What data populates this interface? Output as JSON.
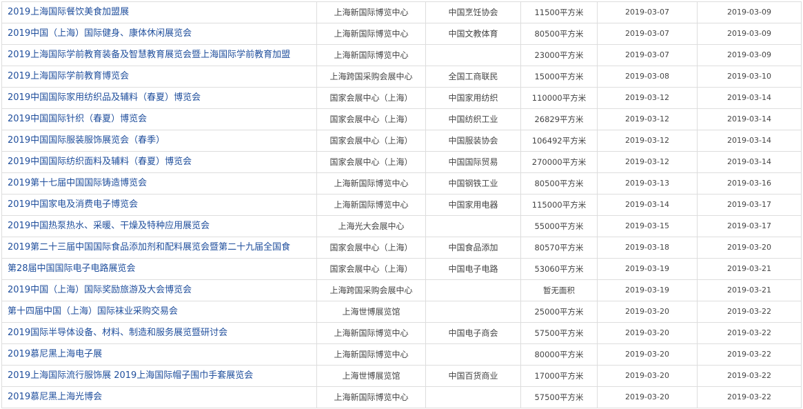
{
  "exhibitions": [
    {
      "name": "2019上海国际餐饮美食加盟展",
      "venue": "上海新国际博览中心",
      "organizer": "中国烹饪协会",
      "area": "11500平方米",
      "start": "2019-03-07",
      "end": "2019-03-09"
    },
    {
      "name": "2019中国（上海）国际健身、康体休闲展览会",
      "venue": "上海新国际博览中心",
      "organizer": "中国文教体育",
      "area": "80500平方米",
      "start": "2019-03-07",
      "end": "2019-03-09"
    },
    {
      "name": "2019上海国际学前教育装备及智慧教育展览会暨上海国际学前教育加盟",
      "venue": "上海新国际博览中心",
      "organizer": "",
      "area": "23000平方米",
      "start": "2019-03-07",
      "end": "2019-03-09"
    },
    {
      "name": "2019上海国际学前教育博览会",
      "venue": "上海跨国采购会展中心",
      "organizer": "全国工商联民",
      "area": "15000平方米",
      "start": "2019-03-08",
      "end": "2019-03-10"
    },
    {
      "name": "2019中国国际家用纺织品及辅料（春夏）博览会",
      "venue": "国家会展中心（上海）",
      "organizer": "中国家用纺织",
      "area": "110000平方米",
      "start": "2019-03-12",
      "end": "2019-03-14"
    },
    {
      "name": "2019中国国际针织（春夏）博览会",
      "venue": "国家会展中心（上海）",
      "organizer": "中国纺织工业",
      "area": "26829平方米",
      "start": "2019-03-12",
      "end": "2019-03-14"
    },
    {
      "name": "2019中国国际服装服饰展览会（春季）",
      "venue": "国家会展中心（上海）",
      "organizer": "中国服装协会",
      "area": "106492平方米",
      "start": "2019-03-12",
      "end": "2019-03-14"
    },
    {
      "name": "2019中国国际纺织面料及辅料（春夏）博览会",
      "venue": "国家会展中心（上海）",
      "organizer": "中国国际贸易",
      "area": "270000平方米",
      "start": "2019-03-12",
      "end": "2019-03-14"
    },
    {
      "name": "2019第十七届中国国际铸造博览会",
      "venue": "上海新国际博览中心",
      "organizer": "中国钢铁工业",
      "area": "80500平方米",
      "start": "2019-03-13",
      "end": "2019-03-16"
    },
    {
      "name": "2019中国家电及消费电子博览会",
      "venue": "上海新国际博览中心",
      "organizer": "中国家用电器",
      "area": "115000平方米",
      "start": "2019-03-14",
      "end": "2019-03-17"
    },
    {
      "name": "2019中国热泵热水、采暖、干燥及特种应用展览会",
      "venue": "上海光大会展中心",
      "organizer": "",
      "area": "55000平方米",
      "start": "2019-03-15",
      "end": "2019-03-17"
    },
    {
      "name": "2019第二十三届中国国际食品添加剂和配料展览会暨第二十九届全国食",
      "venue": "国家会展中心（上海）",
      "organizer": "中国食品添加",
      "area": "80570平方米",
      "start": "2019-03-18",
      "end": "2019-03-20"
    },
    {
      "name": "第28届中国国际电子电路展览会",
      "venue": "国家会展中心（上海）",
      "organizer": "中国电子电路",
      "area": "53060平方米",
      "start": "2019-03-19",
      "end": "2019-03-21"
    },
    {
      "name": "2019中国（上海）国际奖励旅游及大会博览会",
      "venue": "上海跨国采购会展中心",
      "organizer": "",
      "area": "暂无面积",
      "start": "2019-03-19",
      "end": "2019-03-21"
    },
    {
      "name": "第十四届中国（上海）国际袜业采购交易会",
      "venue": "上海世博展览馆",
      "organizer": "",
      "area": "25000平方米",
      "start": "2019-03-20",
      "end": "2019-03-22"
    },
    {
      "name": "2019国际半导体设备、材料、制造和服务展览暨研讨会",
      "venue": "上海新国际博览中心",
      "organizer": "中国电子商会",
      "area": "57500平方米",
      "start": "2019-03-20",
      "end": "2019-03-22"
    },
    {
      "name": "2019慕尼黑上海电子展",
      "venue": "上海新国际博览中心",
      "organizer": "",
      "area": "80000平方米",
      "start": "2019-03-20",
      "end": "2019-03-22"
    },
    {
      "name": "2019上海国际流行服饰展 2019上海国际帽子围巾手套展览会",
      "venue": "上海世博展览馆",
      "organizer": "中国百货商业",
      "area": "17000平方米",
      "start": "2019-03-20",
      "end": "2019-03-22"
    },
    {
      "name": "2019慕尼黑上海光博会",
      "venue": "上海新国际博览中心",
      "organizer": "",
      "area": "57500平方米",
      "start": "2019-03-20",
      "end": "2019-03-22"
    }
  ]
}
